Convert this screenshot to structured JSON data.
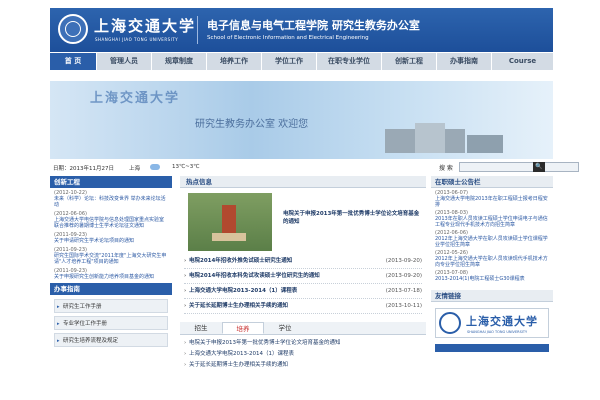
{
  "header": {
    "logo_cn": "上海交通大学",
    "logo_en": "SHANGHAI JIAO TONG UNIVERSITY",
    "title_cn": "电子信息与电气工程学院  研究生教务办公室",
    "title_en": "School of Electronic Information and Electrical Engineering"
  },
  "nav": {
    "items": [
      "首 页",
      "管理人员",
      "规章制度",
      "培养工作",
      "学位工作",
      "在职专业学位",
      "创新工程",
      "办事指南",
      "Course"
    ],
    "active_index": 0
  },
  "banner": {
    "text": "研究生教务办公室  欢迎您"
  },
  "infobar": {
    "date": "日期：2013年11月27日",
    "city": "上海",
    "weather": "13℃~3℃",
    "search_label": "搜 索",
    "search_value": "",
    "search_btn": "🔍"
  },
  "left": {
    "innovation_title": "创新工程",
    "innovation_items": [
      {
        "date": "(2012-10-22)",
        "title": "未来（科学）论坛：科技改变世界 举办未来论坛活动"
      },
      {
        "date": "(2012-06-06)",
        "title": "上海交通大学电信学院与信息处理国家重点实验室联合推荐的暑期博士生学术论坛征文通知"
      },
      {
        "date": "(2011-09-23)",
        "title": "关于申请研究生学术论坛项目的通知"
      },
      {
        "date": "(2011-09-23)",
        "title": "研究生国际学术交流\"2011年度\"上海交大研究生申请\"人才培养工程\"项目的通知"
      },
      {
        "date": "(2011-09-23)",
        "title": "关于申报研究生创新能力培养项目基金的通知"
      }
    ],
    "guide_title": "办事指南",
    "guide_items": [
      "研究生工作手册",
      "专业学位工作手册",
      "研究生培养流程及规定"
    ]
  },
  "mid": {
    "hot_title": "热点信息",
    "feature_title": "电院关于申报2013年第一批优秀博士学位论文培育基金的通知",
    "rows": [
      {
        "title": "电院2014年招收外推免试硕士研究生通知",
        "date": "(2013-09-20)"
      },
      {
        "title": "电院2014年招收本科免试攻读硕士学位研究生的通知",
        "date": "(2013-09-20)"
      },
      {
        "title": "上海交通大学电院2013-2014（1）课程表",
        "date": "(2013-07-18)"
      },
      {
        "title": "关于延长延期博士生办理相关手续的通知",
        "date": "(2013-10-11)"
      }
    ],
    "tabs": [
      "招生",
      "培养",
      "学位"
    ],
    "active_tab": 1,
    "tab_rows": [
      "电院关于申报2013年第一批优秀博士学位论文培育基金的通知",
      "上海交通大学电院2013-2014（1）课程表",
      "关于延长延期博士生办理相关手续的通知"
    ]
  },
  "right": {
    "notice_title": "在职硕士公告栏",
    "notices": [
      {
        "date": "(2013-06-07)",
        "title": "上海交通大学电院2013年在职工程硕士报考日程安排"
      },
      {
        "date": "(2013-08-03)",
        "title": "2013年在职人员攻读工程硕士学位申请电子与通信工程专业现代手机技术方向招生简章"
      },
      {
        "date": "(2012-06-06)",
        "title": "2012年上海交通大学在职人员攻读硕士学位课程学业学位招生简章"
      },
      {
        "date": "(2012-05-26)",
        "title": "2012年上海交通大学在职人员攻读现代手机技术方向专业学位招生简章"
      },
      {
        "date": "(2013-07-08)",
        "title": "2013-2014(1)电院工程硕士G30课程表"
      }
    ],
    "links_title": "友情链接",
    "links_logo_cn": "上海交通大学",
    "links_logo_en": "SHANGHAI JIAO TONG UNIVERSITY"
  },
  "colors": {
    "primary": "#2a5ea9",
    "header": "#1d4f9a",
    "nav": "#d3dbe4",
    "link": "#2b58a3",
    "tab_active": "#c62828"
  }
}
